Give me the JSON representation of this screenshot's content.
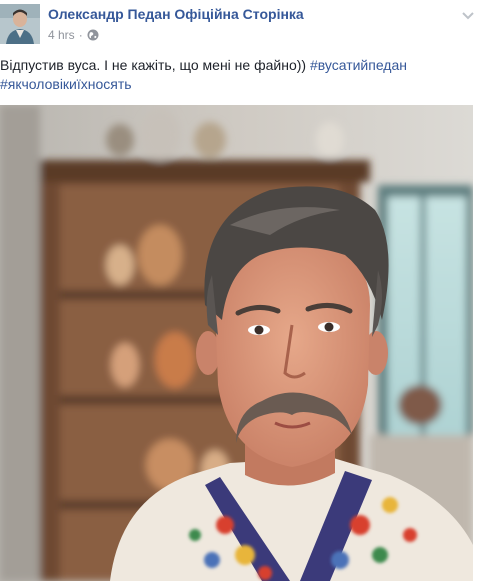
{
  "post": {
    "author_name": "Олександр Педан Офіційна Сторінка",
    "timestamp": "4 hrs",
    "separator": "·",
    "privacy_icon": "globe-icon",
    "options_icon": "chevron-down-icon",
    "text": "Відпустив вуса. І не кажіть, що мені не файно)) ",
    "hashtags": [
      "#вусатийпедан",
      "#якчоловікиїхносять"
    ]
  },
  "colors": {
    "link_blue": "#365899",
    "meta_gray": "#90949c",
    "text_dark": "#1d2129"
  }
}
